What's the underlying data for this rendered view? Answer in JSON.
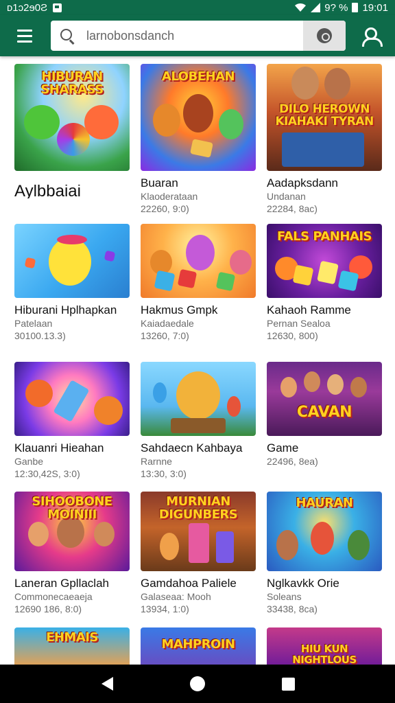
{
  "status_bar": {
    "left_text": "ᴅ1ɔ2ɘ0Ƨ",
    "battery_text": "9? %",
    "time": "19:01",
    "icons": [
      "notification-icon",
      "wifi-icon",
      "signal-icon",
      "battery-icon"
    ]
  },
  "app_bar": {
    "search_value": "larnobonsdanch",
    "search_placeholder": "",
    "icons": [
      "menu-icon",
      "search-icon",
      "voice-search-icon",
      "profile-icon"
    ]
  },
  "colors": {
    "primary": "#0e6b4a",
    "surface": "#ffffff",
    "voice_button_bg": "#e3e3e3"
  },
  "games": [
    {
      "art_text": "HIBURAN SHARASS",
      "title": "Aylbbaiai",
      "subtitle": "",
      "meta": ""
    },
    {
      "art_text": "ALOBEHAN",
      "title": "Buaran",
      "subtitle": "Klaoderataan",
      "meta": "22260, 9:0)"
    },
    {
      "art_text": "DILO HEROWN KIAHAKI TYRAN",
      "title": "Aadapksdann",
      "subtitle": "Undanan",
      "meta": "22284, 8ac)"
    },
    {
      "art_text": "",
      "title": "Hiburani Hplhapkan",
      "subtitle": "Patelaan",
      "meta": "30100.13.3)"
    },
    {
      "art_text": "",
      "title": "Hakmus Gmpk",
      "subtitle": "Kaiadaedale",
      "meta": "13260, 7:0)"
    },
    {
      "art_text": "FALS PANHAIS",
      "title": "Kahaoh Ramme",
      "subtitle": "Pernan Sealoa",
      "meta": "12630, 800)"
    },
    {
      "art_text": "",
      "title": "Klauanri Hieahan",
      "subtitle": "Ganbe",
      "meta": "12:30,42S, 3:0)"
    },
    {
      "art_text": "",
      "title": "Sahdaecn Kahbaya",
      "subtitle": "Rarnne",
      "meta": "13:30, 3:0)"
    },
    {
      "art_text": "CAVAN",
      "title": "Game",
      "subtitle": "",
      "meta": "22496, 8ea)"
    },
    {
      "art_text": "SIHOOBONE MOINIII",
      "title": "Laneran Gpllaclah",
      "subtitle": "Commonecaeaeja",
      "meta": "12690 186, 8:0)"
    },
    {
      "art_text": "MURNIAN DIGUNBERS",
      "title": "Gamdahoa Paliele",
      "subtitle": "Galaseaa: Mooh",
      "meta": "13934, 1:0)"
    },
    {
      "art_text": "HAURAN",
      "title": "Nglkavkk Orie",
      "subtitle": "Soleans",
      "meta": "33438, 8ca)"
    },
    {
      "art_text": "EHMAIS",
      "title": "",
      "subtitle": "",
      "meta": ""
    },
    {
      "art_text": "MAHPROIN",
      "title": "",
      "subtitle": "",
      "meta": ""
    },
    {
      "art_text": "HIU KUN NIGHTLOUS",
      "title": "",
      "subtitle": "",
      "meta": ""
    }
  ]
}
